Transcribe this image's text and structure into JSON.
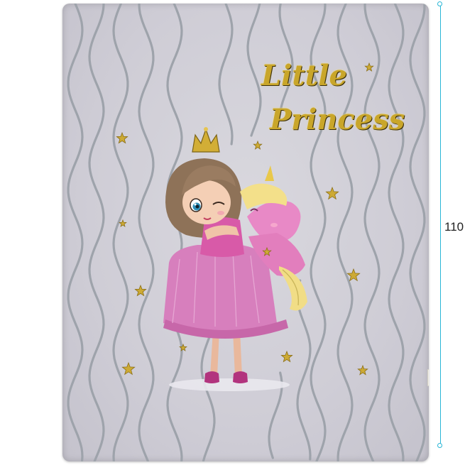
{
  "product": {
    "title_line1": "Little",
    "title_line2": "Princess",
    "height_label": "110"
  },
  "colors": {
    "blanket": "#d2d0d8",
    "stripes": "#9ea3ab",
    "gold": "#c9a62a",
    "dress": "#d77fbd",
    "measure": "#29b6d6"
  },
  "icons": [
    "crown-icon",
    "star-icon",
    "unicorn-icon"
  ]
}
